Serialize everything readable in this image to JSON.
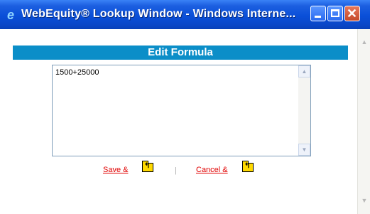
{
  "window": {
    "title": "WebEquity® Lookup Window - Windows Interne..."
  },
  "form": {
    "header": "Edit Formula",
    "formula_value": "1500+25000"
  },
  "actions": {
    "save_label": "Save &",
    "separator": "|",
    "cancel_label": "Cancel &"
  },
  "icons": {
    "browser": "ie-icon",
    "minimize": "minimize-icon",
    "maximize": "maximize-icon",
    "close": "close-icon",
    "folder_up": "folder-up-icon"
  },
  "colors": {
    "titlebar": "#0a4fd8",
    "header_bar": "#0b8ec8",
    "link": "#e00000"
  }
}
